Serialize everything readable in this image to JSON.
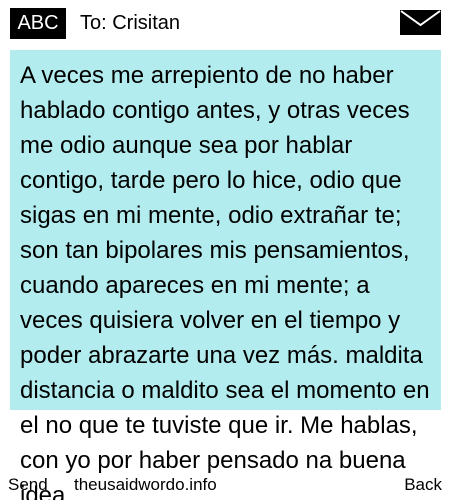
{
  "header": {
    "ime_mode": "ABC",
    "recipient": "To: Crisitan",
    "icon": "envelope-icon"
  },
  "message": {
    "body": "A veces me arrepiento de no haber hablado contigo antes, y otras veces me odio aunque sea por hablar contigo, tarde pero lo hice, odio que sigas en mi mente, odio extrañar te; son tan bipolares mis pensamientos, cuando apareces en mi mente; a veces quisiera volver en el tiempo y poder abrazarte una vez más. maldita distancia o maldito sea el momento en el no que te tuviste que ir. Me hablas, con yo por haber pensado na buena idea",
    "background_color": "#b2ecee"
  },
  "softkeys": {
    "left": "Send",
    "center": "theusaidwordo.info",
    "right": "Back"
  }
}
